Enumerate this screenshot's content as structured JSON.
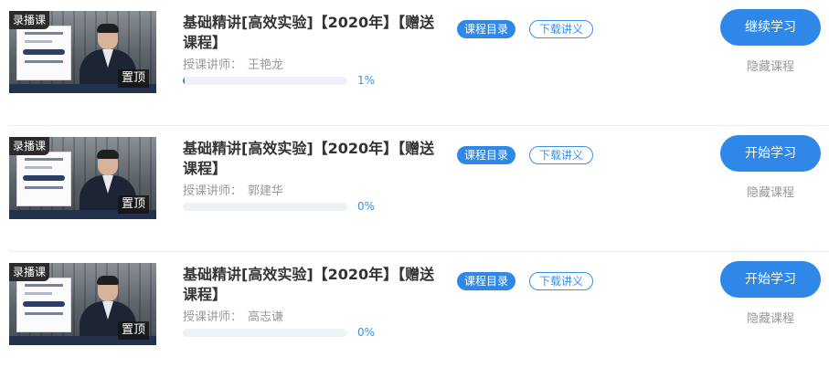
{
  "courses": [
    {
      "tag": "录播课",
      "pin_label": "置顶",
      "title": "基础精讲[高效实验]【2020年】【赠送课程】",
      "teacher_label": "授课讲师：",
      "teacher_name": "王艳龙",
      "progress_text": "1%",
      "progress_value": 0.01,
      "catalog_label": "课程目录",
      "notes_label": "下载讲义",
      "study_label": "继续学习",
      "hide_label": "隐藏课程"
    },
    {
      "tag": "录播课",
      "pin_label": "置顶",
      "title": "基础精讲[高效实验]【2020年】【赠送课程】",
      "teacher_label": "授课讲师：",
      "teacher_name": "郭建华",
      "progress_text": "0%",
      "progress_value": 0.0,
      "catalog_label": "课程目录",
      "notes_label": "下载讲义",
      "study_label": "开始学习",
      "hide_label": "隐藏课程"
    },
    {
      "tag": "录播课",
      "pin_label": "置顶",
      "title": "基础精讲[高效实验]【2020年】【赠送课程】",
      "teacher_label": "授课讲师：",
      "teacher_name": "高志谦",
      "progress_text": "0%",
      "progress_value": 0.0,
      "catalog_label": "课程目录",
      "notes_label": "下载讲义",
      "study_label": "开始学习",
      "hide_label": "隐藏课程"
    }
  ],
  "colors": {
    "accent": "#2f88e8",
    "muted_text": "#999999",
    "title_text": "#333333"
  }
}
